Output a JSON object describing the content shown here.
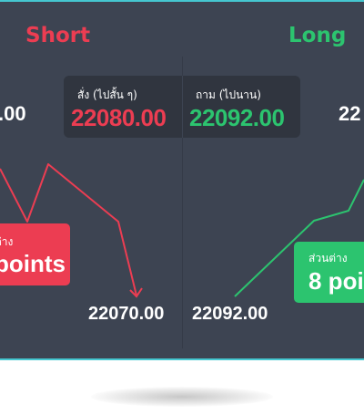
{
  "short": {
    "title": "Short",
    "color": "#ec3d52"
  },
  "long": {
    "title": "Long",
    "color": "#2cc46f"
  },
  "quote": {
    "sell_label": "สั่ง (ไปสั้น ๆ)",
    "sell_price": "22080.00",
    "buy_label": "ถาม (ไปนาน)",
    "buy_price": "22092.00"
  },
  "left_cut_price": ".00",
  "right_cut_price": "22",
  "short_diff": {
    "label": "ต่าง",
    "value": "points"
  },
  "long_diff": {
    "label": "ส่วนต่าง",
    "value": "8 poi"
  },
  "short_end_price": "22070.00",
  "long_end_price": "22092.00",
  "colors": {
    "panel": "#3d4452",
    "border": "#45c7d0",
    "quote_bg": "#30353f"
  }
}
